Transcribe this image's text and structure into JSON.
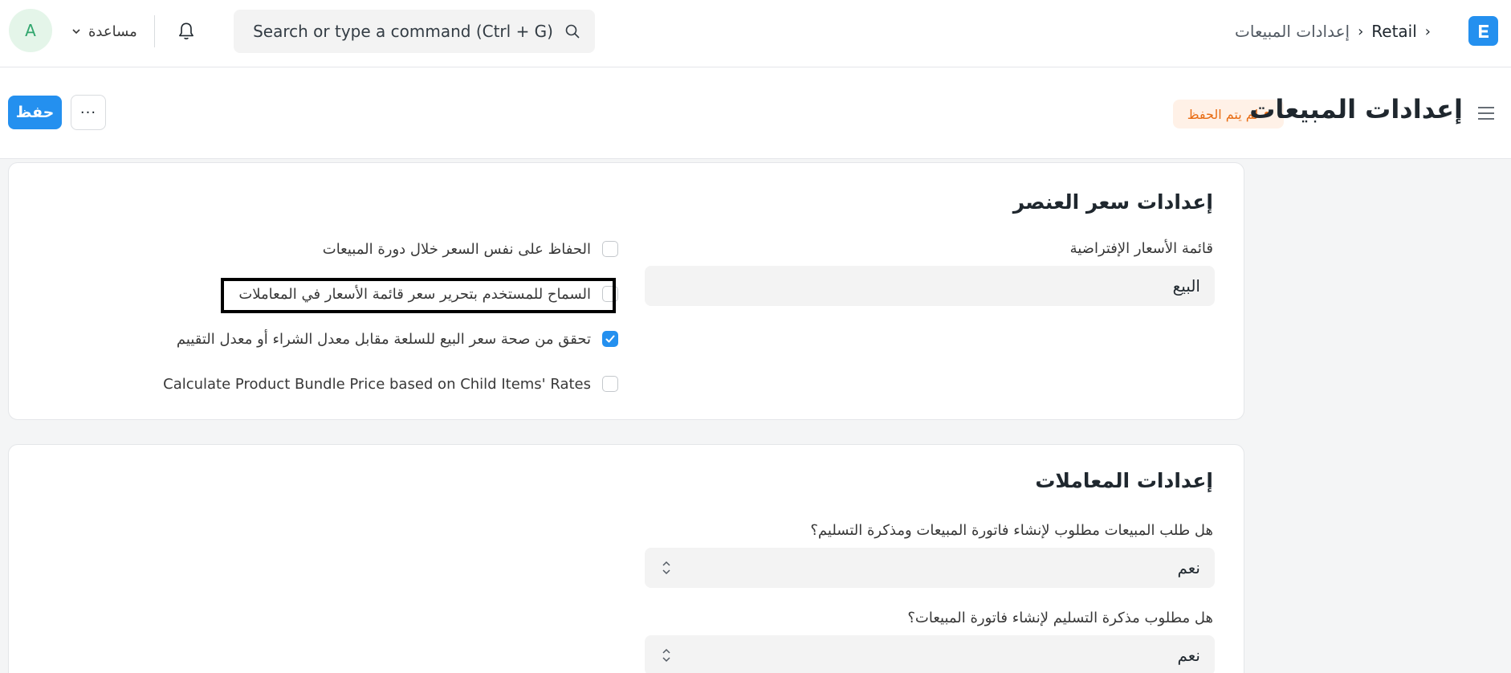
{
  "navbar": {
    "avatar_initial": "A",
    "help_label": "مساعدة",
    "search_placeholder": "Search or type a command (Ctrl + G)",
    "breadcrumbs": [
      "Retail",
      "إعدادات المبيعات"
    ]
  },
  "page_head": {
    "title": "إعدادات المبيعات",
    "status": "لم يتم الحفظ",
    "save_label": "حفظ",
    "more_label": "···"
  },
  "item_price_section": {
    "title": "إعدادات سعر العنصر",
    "default_price_list_label": "قائمة الأسعار الإفتراضية",
    "default_price_list_value": "البيع",
    "checkboxes": [
      {
        "label": "الحفاظ على نفس السعر خلال دورة المبيعات",
        "checked": false
      },
      {
        "label": "السماح للمستخدم بتحرير سعر قائمة الأسعار في المعاملات",
        "checked": false
      },
      {
        "label": "تحقق من صحة سعر البيع للسلعة مقابل معدل الشراء أو معدل التقييم",
        "checked": true
      },
      {
        "label": "Calculate Product Bundle Price based on Child Items' Rates",
        "checked": false
      }
    ]
  },
  "transactions_section": {
    "title": "إعدادات المعاملات",
    "so_required_label": "هل طلب المبيعات مطلوب لإنشاء فاتورة المبيعات ومذكرة التسليم؟",
    "so_required_value": "نعم",
    "dn_required_label": "هل مطلوب مذكرة التسليم لإنشاء فاتورة المبيعات؟",
    "dn_required_value": "نعم"
  },
  "colors": {
    "primary": "#2490ef",
    "unsaved": "#e86c13",
    "unsaved_bg": "#fff1e7"
  }
}
